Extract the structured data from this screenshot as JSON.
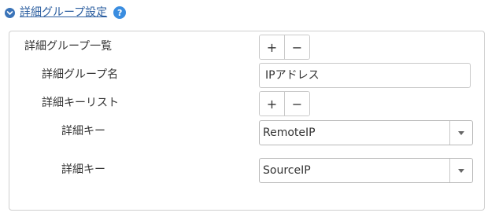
{
  "header": {
    "title": "詳細グループ設定",
    "help_symbol": "?"
  },
  "panel": {
    "group_list": {
      "label": "詳細グループ一覧",
      "add_label": "+",
      "remove_label": "−"
    },
    "group_name": {
      "label": "詳細グループ名",
      "value": "IPアドレス"
    },
    "key_list": {
      "label": "詳細キーリスト",
      "add_label": "+",
      "remove_label": "−"
    },
    "keys": [
      {
        "label": "詳細キー",
        "selected": "RemoteIP"
      },
      {
        "label": "詳細キー",
        "selected": "SourceIP"
      }
    ]
  },
  "colors": {
    "link": "#2a5d9f",
    "accent": "#3a73b8",
    "help": "#3a8de0",
    "border": "#cfcfcf"
  }
}
